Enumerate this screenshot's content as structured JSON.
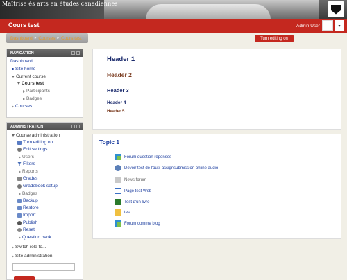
{
  "banner": {
    "title": "Maîtrise ès arts en études canadiennes"
  },
  "header": {
    "course_title": "Cours test",
    "user_name": "Admin User",
    "user_menu_glyph": "▾"
  },
  "breadcrumb": {
    "items": [
      "Dashboard",
      "Courses",
      "Cours test"
    ],
    "sep": "▸"
  },
  "edit_button": "Turn editing on",
  "navigation": {
    "title": "NAVIGATION",
    "dashboard": "Dashboard",
    "site_home": "Site home",
    "current_course": "Current course",
    "course": "Cours test",
    "participants": "Participants",
    "badges": "Badges",
    "courses": "Courses"
  },
  "administration": {
    "title": "ADMINISTRATION",
    "course_admin": "Course administration",
    "items": [
      "Turn editing on",
      "Edit settings",
      "Users",
      "Filters",
      "Reports",
      "Grades",
      "Gradebook setup",
      "Badges",
      "Backup",
      "Restore",
      "Import",
      "Publish",
      "Reset",
      "Question bank"
    ],
    "switch_role": "Switch role to...",
    "site_admin": "Site administration"
  },
  "main": {
    "headers": [
      "Header 1",
      "Header 2",
      "Header 3",
      "Header 4",
      "Header 5"
    ],
    "topic_title": "Topic 1",
    "activities": [
      "Forum question réponses",
      "Devoir test de l'outil assignsubmission online audio",
      "News forum",
      "Page test Web",
      "Test d'un livre",
      "test",
      "Forum comme blog"
    ]
  },
  "colors": {
    "brand_red": "#c4281f",
    "link_blue": "#1a3c9e",
    "header2_brown": "#7a3b1f"
  }
}
